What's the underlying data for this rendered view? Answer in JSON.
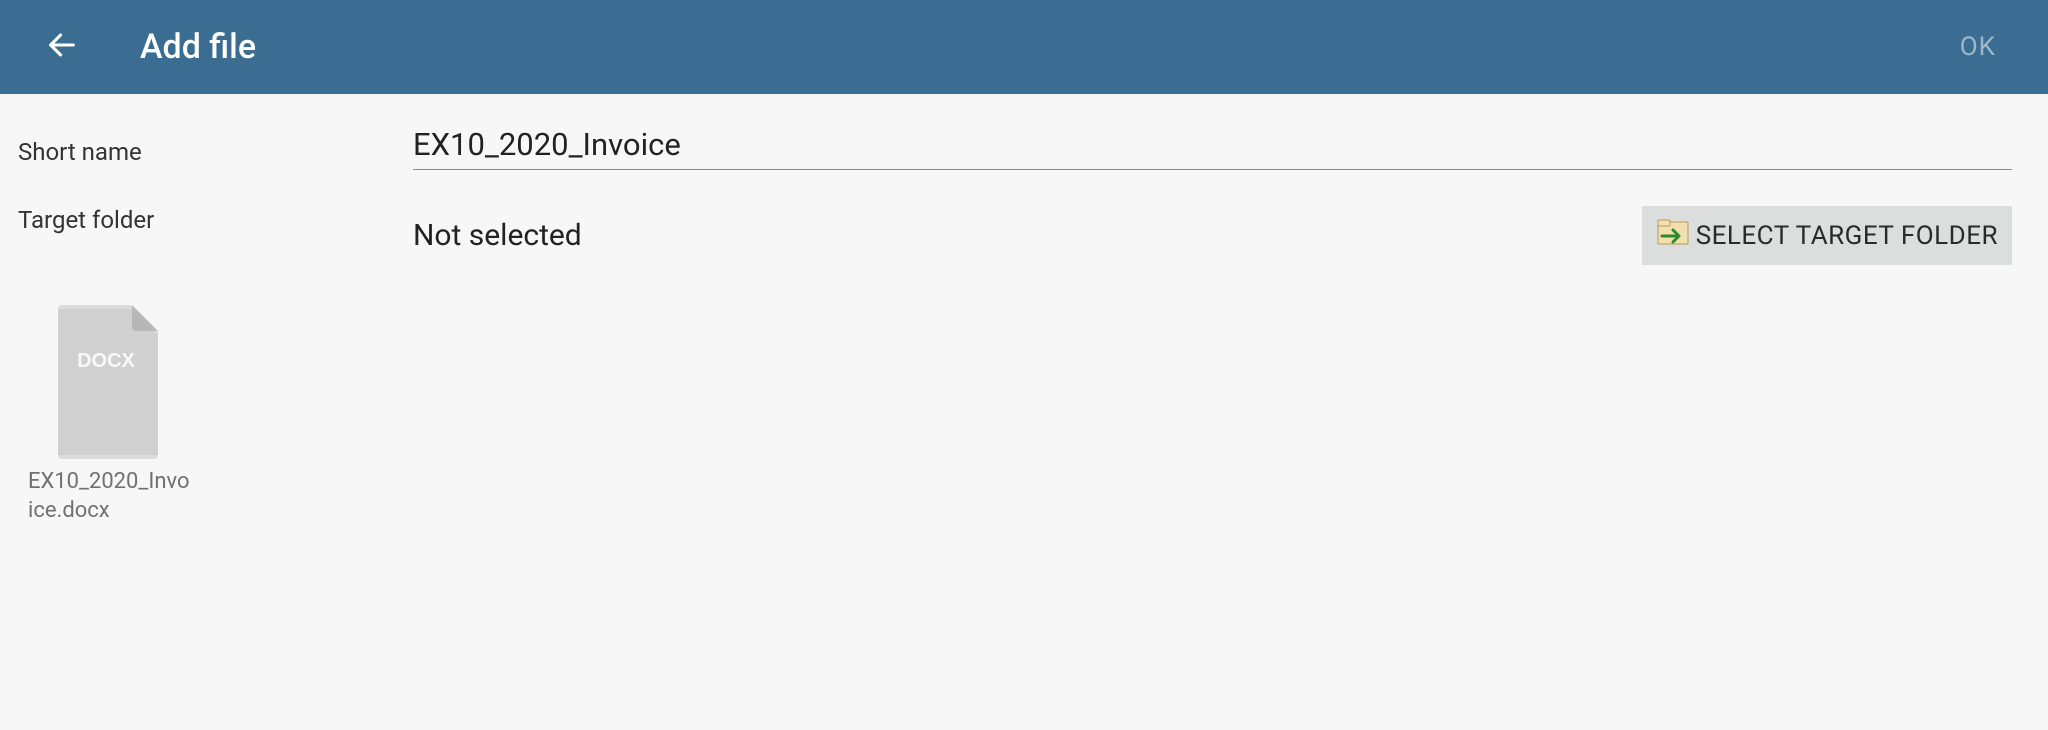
{
  "header": {
    "title": "Add file",
    "ok_label": "OK"
  },
  "form": {
    "short_name_label": "Short name",
    "short_name_value": "EX10_2020_Invoice",
    "target_folder_label": "Target folder",
    "target_folder_status": "Not selected",
    "select_folder_button": "SELECT TARGET FOLDER"
  },
  "file": {
    "badge": "DOCX",
    "name": "EX10_2020_Invoice.docx"
  },
  "colors": {
    "header_bg": "#3a6d91",
    "page_bg": "#f7f7f7",
    "button_bg": "#dcdddd",
    "file_icon_fill": "#c6c6c6",
    "file_icon_fold": "#ababab"
  }
}
